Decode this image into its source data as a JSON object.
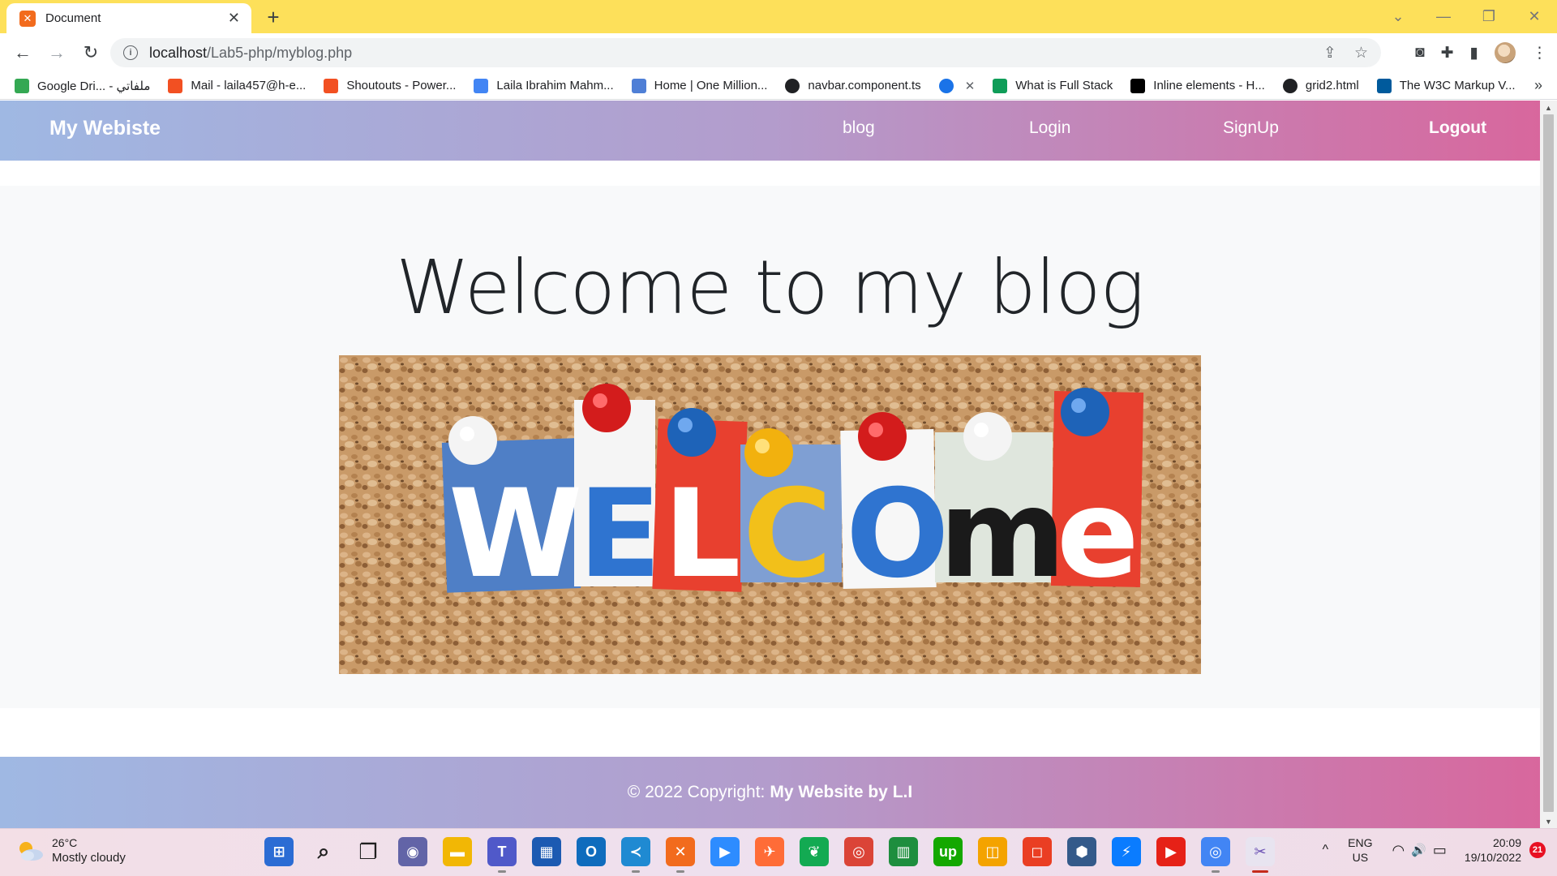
{
  "browser": {
    "tab": {
      "title": "Document",
      "close": "✕"
    },
    "new_tab": "+",
    "window_controls": {
      "dropdown": "⌄",
      "minimize": "—",
      "restore": "❐",
      "close": "✕"
    },
    "nav": {
      "back": "←",
      "forward": "→",
      "reload": "↻"
    },
    "url": {
      "host": "localhost",
      "path": "/Lab5-php/myblog.php"
    },
    "bookmarks": [
      {
        "label": "Google Dri... - ملفاتي",
        "icon": "google-drive-icon",
        "color": "#34a853"
      },
      {
        "label": "Mail - laila457@h-e...",
        "icon": "microsoft-icon",
        "color": "#f25022"
      },
      {
        "label": "Shoutouts - Power...",
        "icon": "microsoft-icon",
        "color": "#f25022"
      },
      {
        "label": "Laila Ibrahim Mahm...",
        "icon": "pinwheel-icon",
        "color": "#4285f4"
      },
      {
        "label": "Home | One Million...",
        "icon": "one-million-icon",
        "color": "#4f7fd6"
      },
      {
        "label": "navbar.component.ts",
        "icon": "globe-icon",
        "color": "#202124"
      },
      {
        "label": "",
        "icon": "c-icon",
        "color": "#1a73e8"
      },
      {
        "label": "What is Full Stack",
        "icon": "w3-icon",
        "color": "#0f9d58"
      },
      {
        "label": "Inline elements - H...",
        "icon": "mdn-icon",
        "color": "#000000"
      },
      {
        "label": "grid2.html",
        "icon": "globe-icon",
        "color": "#202124"
      },
      {
        "label": "The W3C Markup V...",
        "icon": "w3c-icon",
        "color": "#005a9c"
      }
    ],
    "bookmarks_more": "»"
  },
  "site": {
    "brand": "My Webiste",
    "nav": {
      "blog": "blog",
      "login": "Login",
      "signup": "SignUp",
      "logout": "Logout"
    },
    "hero_title": "Welcome to my blog",
    "image_letters": [
      "W",
      "E",
      "L",
      "C",
      "O",
      "m",
      "e"
    ],
    "footer": {
      "prefix": "© 2022 Copyright:",
      "owner": "My Website by L.I"
    },
    "gradient": {
      "start": "#9fb8e3",
      "end": "#d8679d"
    }
  },
  "taskbar": {
    "weather": {
      "temp": "26°C",
      "desc": "Mostly cloudy"
    },
    "apps": [
      {
        "name": "start-icon",
        "color": "#2b6cd4",
        "glyph": "⊞"
      },
      {
        "name": "search-icon",
        "color": "transparent",
        "glyph": "⌕"
      },
      {
        "name": "task-view-icon",
        "color": "#333333",
        "glyph": "❐"
      },
      {
        "name": "chat-icon",
        "color": "#6264a7",
        "glyph": "◉"
      },
      {
        "name": "file-explorer-icon",
        "color": "#f2b705",
        "glyph": "▬"
      },
      {
        "name": "teams-icon",
        "color": "#5059c9",
        "glyph": "T"
      },
      {
        "name": "store-icon",
        "color": "#1c5ab2",
        "glyph": "▦"
      },
      {
        "name": "outlook-icon",
        "color": "#0f6cbd",
        "glyph": "O"
      },
      {
        "name": "vscode-icon",
        "color": "#1f8ad2",
        "glyph": "≺"
      },
      {
        "name": "xampp-icon",
        "color": "#f26b1d",
        "glyph": "✕"
      },
      {
        "name": "zoom-icon",
        "color": "#2d8cff",
        "glyph": "▶"
      },
      {
        "name": "postman-icon",
        "color": "#ff6c37",
        "glyph": "✈"
      },
      {
        "name": "mongodb-icon",
        "color": "#13aa52",
        "glyph": "❦"
      },
      {
        "name": "chrome-icon",
        "color": "#db4437",
        "glyph": "◎"
      },
      {
        "name": "sheets-icon",
        "color": "#1e8e3e",
        "glyph": "▥"
      },
      {
        "name": "upwork-icon",
        "color": "#14a800",
        "glyph": "up"
      },
      {
        "name": "virtualbox-icon",
        "color": "#f4a300",
        "glyph": "◫"
      },
      {
        "name": "office-icon",
        "color": "#ea3e23",
        "glyph": "◻"
      },
      {
        "name": "3d-box-icon",
        "color": "#345a8a",
        "glyph": "⬢"
      },
      {
        "name": "messenger-icon",
        "color": "#0a7cff",
        "glyph": "⚡"
      },
      {
        "name": "youtube-icon",
        "color": "#e62117",
        "glyph": "▶"
      },
      {
        "name": "chrome-profile-icon",
        "color": "#4285f4",
        "glyph": "◎"
      },
      {
        "name": "snipping-tool-icon",
        "color": "#e8e4f0",
        "glyph": "✂"
      }
    ],
    "tray": {
      "chevron": "^",
      "lang_top": "ENG",
      "lang_bottom": "US",
      "wifi": "◠",
      "volume": "🔊",
      "battery": "▭",
      "time": "20:09",
      "date": "19/10/2022",
      "notifications": "21"
    }
  }
}
